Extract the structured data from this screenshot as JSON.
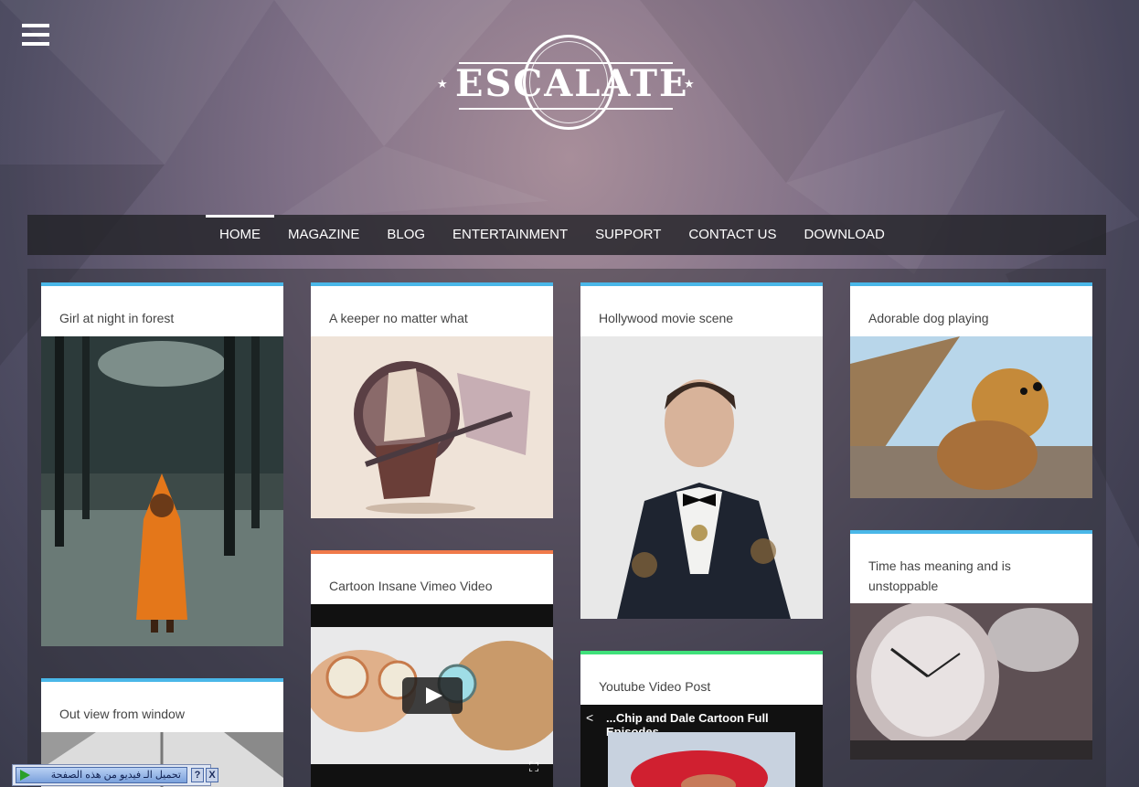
{
  "logo": {
    "text": "ESCALATE"
  },
  "nav": {
    "items": [
      "HOME",
      "MAGAZINE",
      "BLOG",
      "ENTERTAINMENT",
      "SUPPORT",
      "CONTACT US",
      "DOWNLOAD"
    ],
    "active": "HOME"
  },
  "posts": {
    "girl": {
      "title": "Girl at night in forest",
      "accent": "#4ab7e8"
    },
    "keeper": {
      "title": "A keeper no matter what",
      "accent": "#4ab7e8"
    },
    "hollywood": {
      "title": "Hollywood movie scene",
      "accent": "#4ab7e8"
    },
    "dog": {
      "title": "Adorable dog playing",
      "accent": "#4ab7e8"
    },
    "window": {
      "title": "Out view from window",
      "accent": "#4ab7e8"
    },
    "vimeo": {
      "title": "Cartoon Insane Vimeo Video",
      "accent": "#f07a4a"
    },
    "youtube": {
      "title": "Youtube Video Post",
      "accent": "#3fe07a",
      "video_title": "...Chip and Dale Cartoon Full Episodes"
    },
    "time": {
      "title": "Time has meaning and is unstoppable",
      "accent": "#4ab7e8"
    }
  },
  "extension_bar": {
    "label": "تحميل الـ فيديو من هذه الصفحة",
    "help": "?",
    "close": "X"
  }
}
